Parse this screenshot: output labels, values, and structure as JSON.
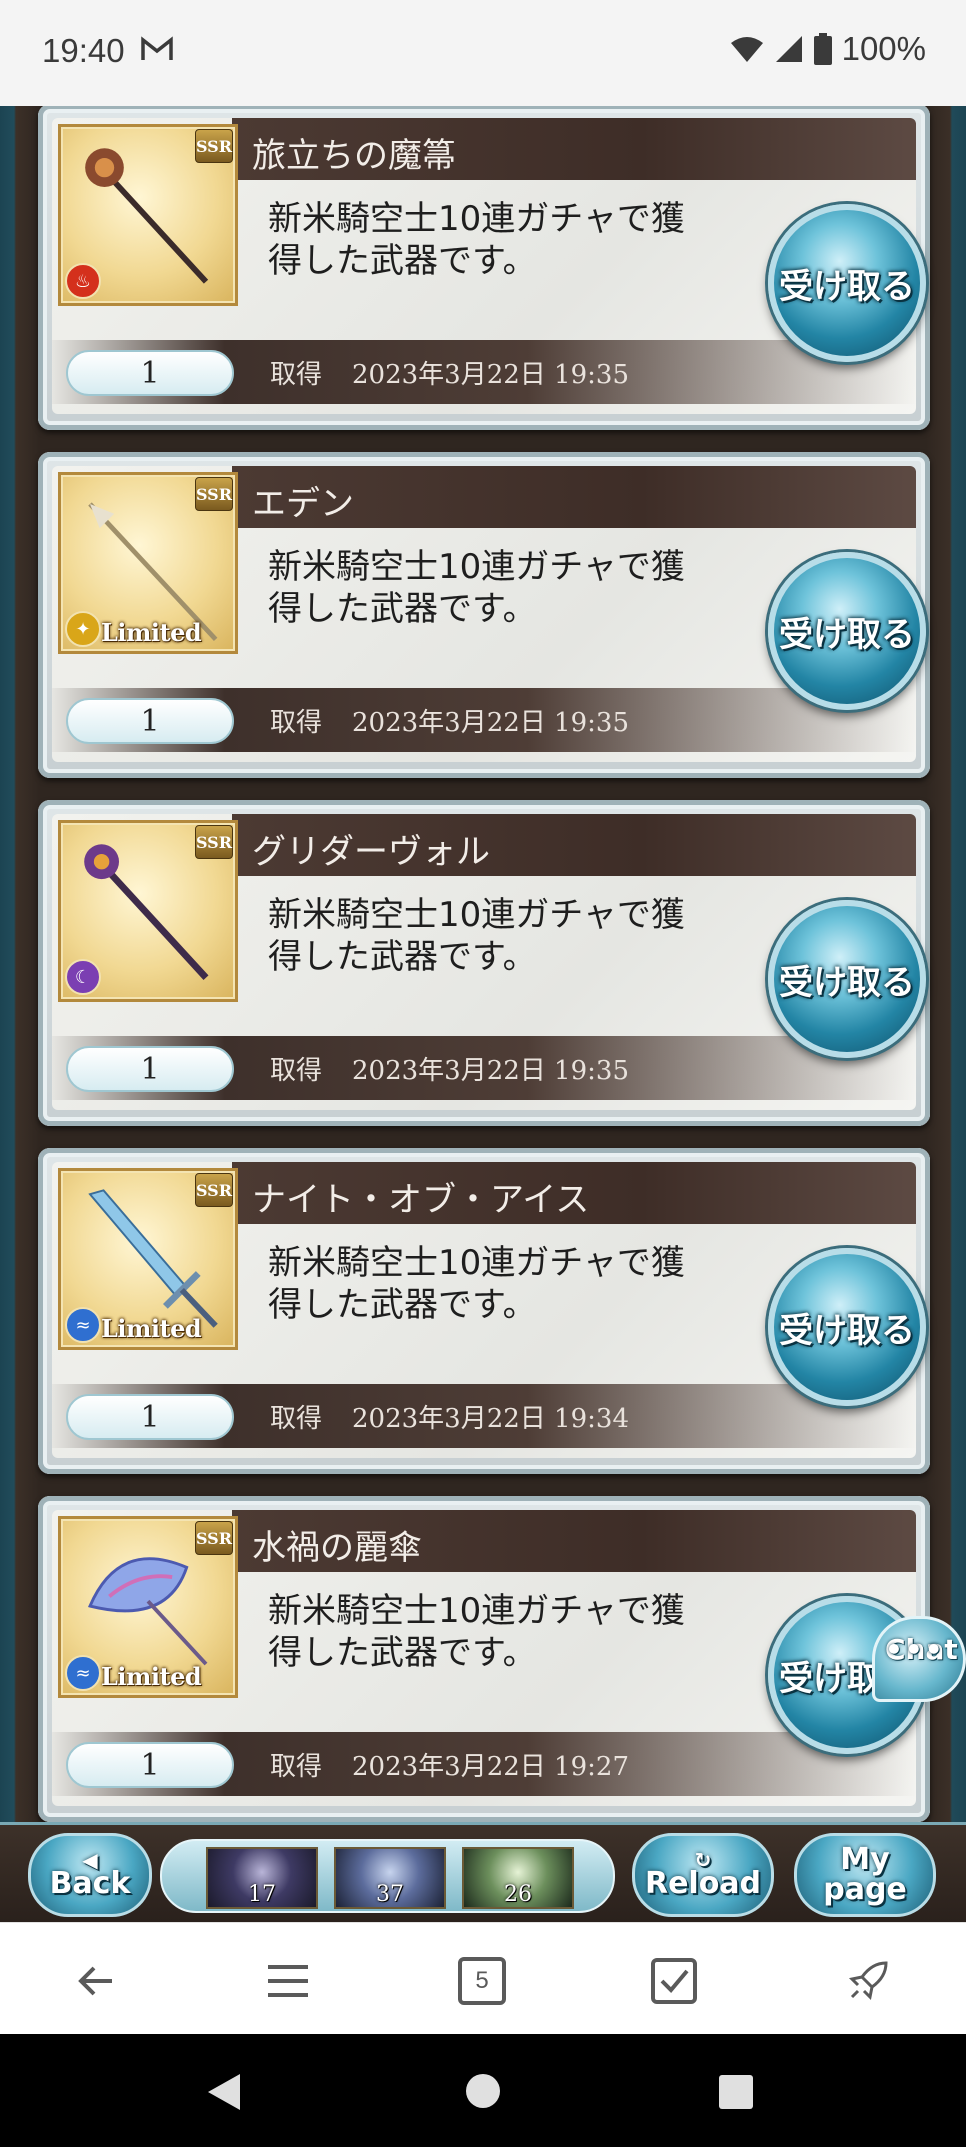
{
  "status_bar": {
    "time": "19:40",
    "battery": "100%",
    "icons": [
      "gmail-icon",
      "wifi-icon",
      "signal-icon",
      "battery-icon"
    ]
  },
  "items": [
    {
      "name": "旅立ちの魔箒",
      "rarity": "SSR",
      "element": "fire",
      "limited": "",
      "description_line1": "新米騎空士10連ガチャで獲",
      "description_line2": "得した武器です。",
      "quantity": "1",
      "acquired_label": "取得",
      "acquired_date": "2023年3月22日 19:35",
      "receive_label": "受け取る"
    },
    {
      "name": "エデン",
      "rarity": "SSR",
      "element": "light",
      "limited": "Limited",
      "description_line1": "新米騎空士10連ガチャで獲",
      "description_line2": "得した武器です。",
      "quantity": "1",
      "acquired_label": "取得",
      "acquired_date": "2023年3月22日 19:35",
      "receive_label": "受け取る"
    },
    {
      "name": "グリダーヴォル",
      "rarity": "SSR",
      "element": "dark",
      "limited": "",
      "description_line1": "新米騎空士10連ガチャで獲",
      "description_line2": "得した武器です。",
      "quantity": "1",
      "acquired_label": "取得",
      "acquired_date": "2023年3月22日 19:35",
      "receive_label": "受け取る"
    },
    {
      "name": "ナイト・オブ・アイス",
      "rarity": "SSR",
      "element": "water",
      "limited": "Limited",
      "description_line1": "新米騎空士10連ガチャで獲",
      "description_line2": "得した武器です。",
      "quantity": "1",
      "acquired_label": "取得",
      "acquired_date": "2023年3月22日 19:34",
      "receive_label": "受け取る"
    },
    {
      "name": "水禍の麗傘",
      "rarity": "SSR",
      "element": "water",
      "limited": "Limited",
      "description_line1": "新米騎空士10連ガチャで獲",
      "description_line2": "得した武器です。",
      "quantity": "1",
      "acquired_label": "取得",
      "acquired_date": "2023年3月22日 19:27",
      "receive_label": "受け取る"
    }
  ],
  "chat_button": {
    "label": "Chat",
    "dots": "•••"
  },
  "game_bar": {
    "back_label": "Back",
    "reload_label": "Reload",
    "mypage_line1": "My",
    "mypage_line2": "page",
    "item_counts": [
      "17",
      "37",
      "26"
    ]
  },
  "browser_bar": {
    "tab_count": "5",
    "icons": [
      "back-arrow-icon",
      "menu-icon",
      "tabs-icon",
      "checkbox-icon",
      "rocket-icon"
    ]
  },
  "colors": {
    "card_header": "#3e2d27",
    "button_blue": "#2385a5",
    "background": "#2f2620"
  }
}
